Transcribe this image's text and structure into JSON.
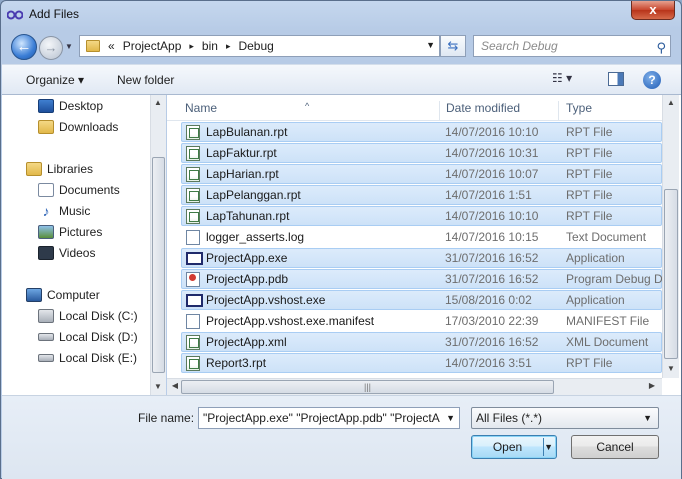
{
  "window": {
    "title": "Add Files",
    "close_label": "x"
  },
  "address": {
    "crumbs": [
      "ProjectApp",
      "bin",
      "Debug"
    ],
    "overflow": "«",
    "separator": "▸"
  },
  "search": {
    "placeholder": "Search Debug"
  },
  "toolbar": {
    "organize_label": "Organize ▾",
    "new_folder_label": "New folder"
  },
  "nav": {
    "favorites": [
      {
        "label": "Desktop",
        "icon": "desktop-icon"
      },
      {
        "label": "Downloads",
        "icon": "downloads-icon"
      }
    ],
    "libraries_label": "Libraries",
    "libraries": [
      {
        "label": "Documents",
        "icon": "documents-icon"
      },
      {
        "label": "Music",
        "icon": "music-icon"
      },
      {
        "label": "Pictures",
        "icon": "pictures-icon"
      },
      {
        "label": "Videos",
        "icon": "videos-icon"
      }
    ],
    "computer_label": "Computer",
    "drives": [
      {
        "label": "Local Disk (C:)"
      },
      {
        "label": "Local Disk (D:)"
      },
      {
        "label": "Local Disk (E:)"
      }
    ]
  },
  "columns": {
    "name": "Name",
    "date": "Date modified",
    "type": "Type"
  },
  "files": [
    {
      "name": "LapBulanan.rpt",
      "date": "14/07/2016 10:10",
      "type": "RPT File",
      "icon": "rpt",
      "selected": true
    },
    {
      "name": "LapFaktur.rpt",
      "date": "14/07/2016 10:31",
      "type": "RPT File",
      "icon": "rpt",
      "selected": true
    },
    {
      "name": "LapHarian.rpt",
      "date": "14/07/2016 10:07",
      "type": "RPT File",
      "icon": "rpt",
      "selected": true
    },
    {
      "name": "LapPelanggan.rpt",
      "date": "14/07/2016 1:51",
      "type": "RPT File",
      "icon": "rpt",
      "selected": true
    },
    {
      "name": "LapTahunan.rpt",
      "date": "14/07/2016 10:10",
      "type": "RPT File",
      "icon": "rpt",
      "selected": true
    },
    {
      "name": "logger_asserts.log",
      "date": "14/07/2016 10:15",
      "type": "Text Document",
      "icon": "txt",
      "selected": false
    },
    {
      "name": "ProjectApp.exe",
      "date": "31/07/2016 16:52",
      "type": "Application",
      "icon": "exe",
      "selected": true
    },
    {
      "name": "ProjectApp.pdb",
      "date": "31/07/2016 16:52",
      "type": "Program Debug D",
      "icon": "pdb",
      "selected": true
    },
    {
      "name": "ProjectApp.vshost.exe",
      "date": "15/08/2016 0:02",
      "type": "Application",
      "icon": "exe",
      "selected": true
    },
    {
      "name": "ProjectApp.vshost.exe.manifest",
      "date": "17/03/2010 22:39",
      "type": "MANIFEST File",
      "icon": "txt",
      "selected": false
    },
    {
      "name": "ProjectApp.xml",
      "date": "31/07/2016 16:52",
      "type": "XML Document",
      "icon": "rpt",
      "selected": true
    },
    {
      "name": "Report3.rpt",
      "date": "14/07/2016 3:51",
      "type": "RPT File",
      "icon": "rpt",
      "selected": true
    }
  ],
  "bottom": {
    "file_name_label": "File name:",
    "file_name_value": "\"ProjectApp.exe\" \"ProjectApp.pdb\" \"ProjectA",
    "filter_value": "All Files (*.*)",
    "open_label": "Open",
    "cancel_label": "Cancel"
  }
}
